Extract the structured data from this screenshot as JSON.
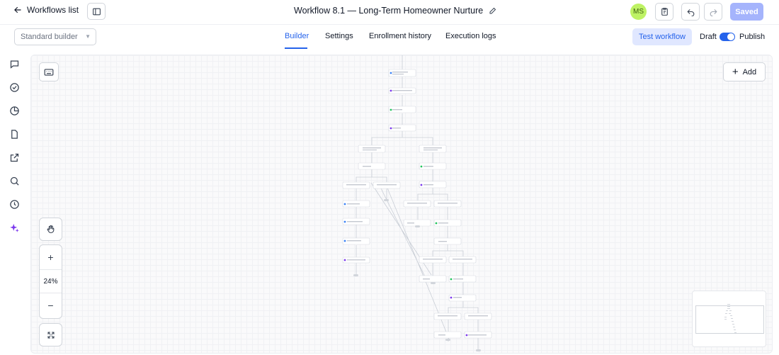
{
  "header": {
    "back_label": "Workflows list",
    "title": "Workflow 8.1 — Long-Term Homeowner Nurture",
    "avatar_initials": "MS",
    "saved_label": "Saved"
  },
  "subbar": {
    "builder_select": "Standard builder",
    "tabs": [
      {
        "label": "Builder",
        "active": true
      },
      {
        "label": "Settings",
        "active": false
      },
      {
        "label": "Enrollment history",
        "active": false
      },
      {
        "label": "Execution logs",
        "active": false
      }
    ],
    "test_workflow_label": "Test workflow",
    "draft_label": "Draft",
    "publish_label": "Publish",
    "publish_toggle_on": true
  },
  "rail": {
    "icons": [
      "chat-icon",
      "check-circle-icon",
      "pie-chart-icon",
      "document-icon",
      "external-link-icon",
      "search-icon",
      "history-icon",
      "sparkles-icon"
    ]
  },
  "canvas": {
    "add_label": "Add",
    "zoom_level": "24%",
    "accent_color": "#7c3aed"
  }
}
